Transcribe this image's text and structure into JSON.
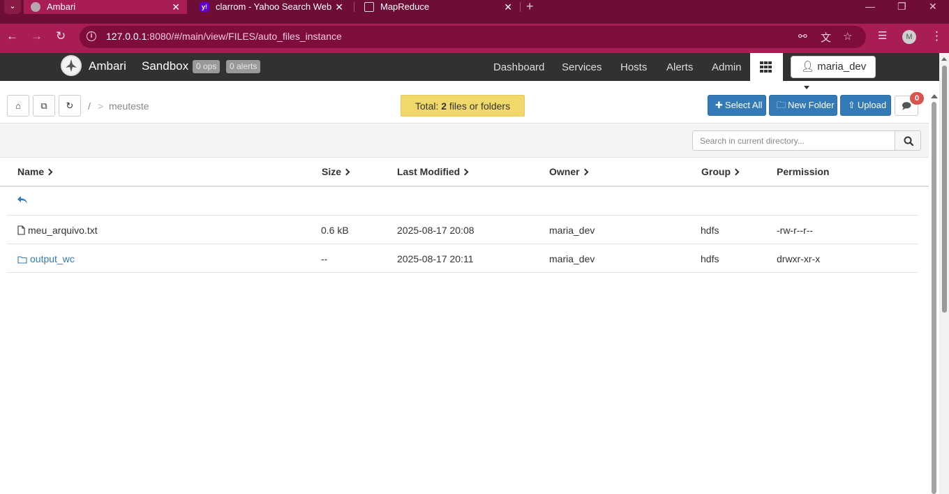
{
  "browser": {
    "tabs": [
      {
        "title": "Ambari",
        "active": true
      },
      {
        "title": "clarrom - Yahoo Search Web",
        "active": false
      },
      {
        "title": "MapReduce",
        "active": false
      }
    ],
    "url_host": "127.0.0.1",
    "url_rest": ":8080/#/main/view/FILES/auto_files_instance",
    "profile_initial": "M"
  },
  "navbar": {
    "brand": "Ambari",
    "cluster": "Sandbox",
    "ops_badge": "0 ops",
    "alerts_badge": "0 alerts",
    "links": [
      "Dashboard",
      "Services",
      "Hosts",
      "Alerts",
      "Admin"
    ],
    "user": "maria_dev"
  },
  "toolbar": {
    "breadcrumb_root": "/",
    "breadcrumb_sep": ">",
    "breadcrumb_current": "meuteste",
    "total_prefix": "Total: ",
    "total_count": "2",
    "total_suffix": " files or folders",
    "select_all": "Select All",
    "new_folder": "New Folder",
    "upload": "Upload",
    "messages_count": "0"
  },
  "search": {
    "placeholder": "Search in current directory..."
  },
  "table": {
    "columns": [
      "Name",
      "Size",
      "Last Modified",
      "Owner",
      "Group",
      "Permission"
    ],
    "rows": [
      {
        "type": "file",
        "name": "meu_arquivo.txt",
        "size": "0.6 kB",
        "modified": "2025-08-17 20:08",
        "owner": "maria_dev",
        "group": "hdfs",
        "permission": "-rw-r--r--"
      },
      {
        "type": "folder",
        "name": "output_wc",
        "size": "--",
        "modified": "2025-08-17 20:11",
        "owner": "maria_dev",
        "group": "hdfs",
        "permission": "drwxr-xr-x"
      }
    ]
  },
  "colors": {
    "browser_tabbar": "#6e0d36",
    "browser_toolbar": "#a81d55",
    "ambari_navbar": "#313131",
    "primary_button": "#337ab7",
    "total_badge": "#f0d86a",
    "message_badge": "#d9534f"
  }
}
